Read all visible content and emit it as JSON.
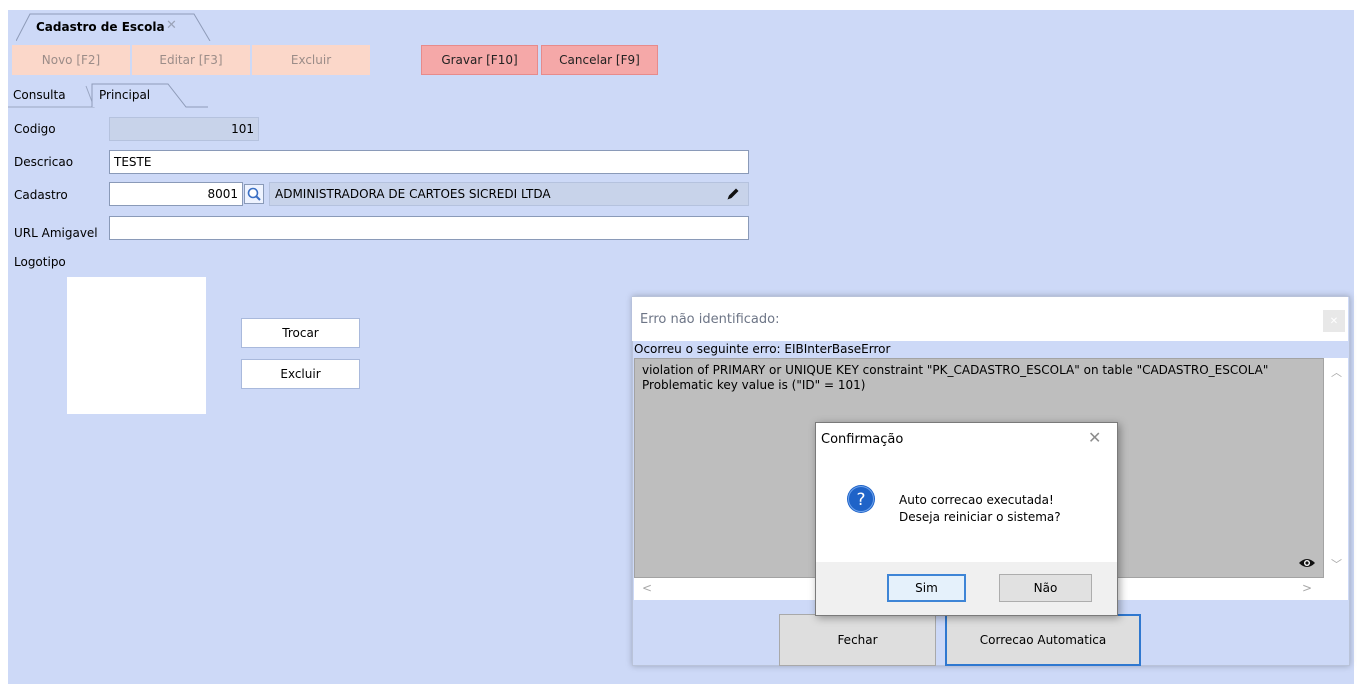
{
  "document_tab": {
    "label": "Cadastro de Escola",
    "close": "✕"
  },
  "toolbar": {
    "novo": "Novo [F2]",
    "editar": "Editar [F3]",
    "excluir": "Excluir",
    "gravar": "Gravar [F10]",
    "cancelar": "Cancelar [F9]"
  },
  "tabs": {
    "consulta": "Consulta",
    "principal": "Principal"
  },
  "form": {
    "codigo_label": "Codigo",
    "codigo_value": "101",
    "descricao_label": "Descricao",
    "descricao_value": "TESTE",
    "cadastro_label": "Cadastro",
    "cadastro_code": "8001",
    "cadastro_name": "ADMINISTRADORA DE CARTOES SICREDI LTDA",
    "url_label": "URL Amigavel",
    "url_value": "",
    "logotipo_label": "Logotipo",
    "trocar": "Trocar",
    "excluir": "Excluir"
  },
  "error_dialog": {
    "title": "Erro não identificado:",
    "subtitle": "Ocorreu o seguinte erro: EIBInterBaseError",
    "message_line1": "violation of PRIMARY or UNIQUE KEY constraint \"PK_CADASTRO_ESCOLA\" on table \"CADASTRO_ESCOLA\"",
    "message_line2": "Problematic key value is (\"ID\" = 101)",
    "fechar": "Fechar",
    "correcao": "Correcao Automatica"
  },
  "confirm_dialog": {
    "title": "Confirmação",
    "line1": "Auto correcao executada!",
    "line2": "Deseja reiniciar o sistema?",
    "sim": "Sim",
    "nao": "Não"
  },
  "colors": {
    "app_background": "#cdd9f7",
    "toolbar_disabled": "#fbd7c9",
    "toolbar_active": "#f5a8a8",
    "focus_blue": "#2f78d0"
  }
}
